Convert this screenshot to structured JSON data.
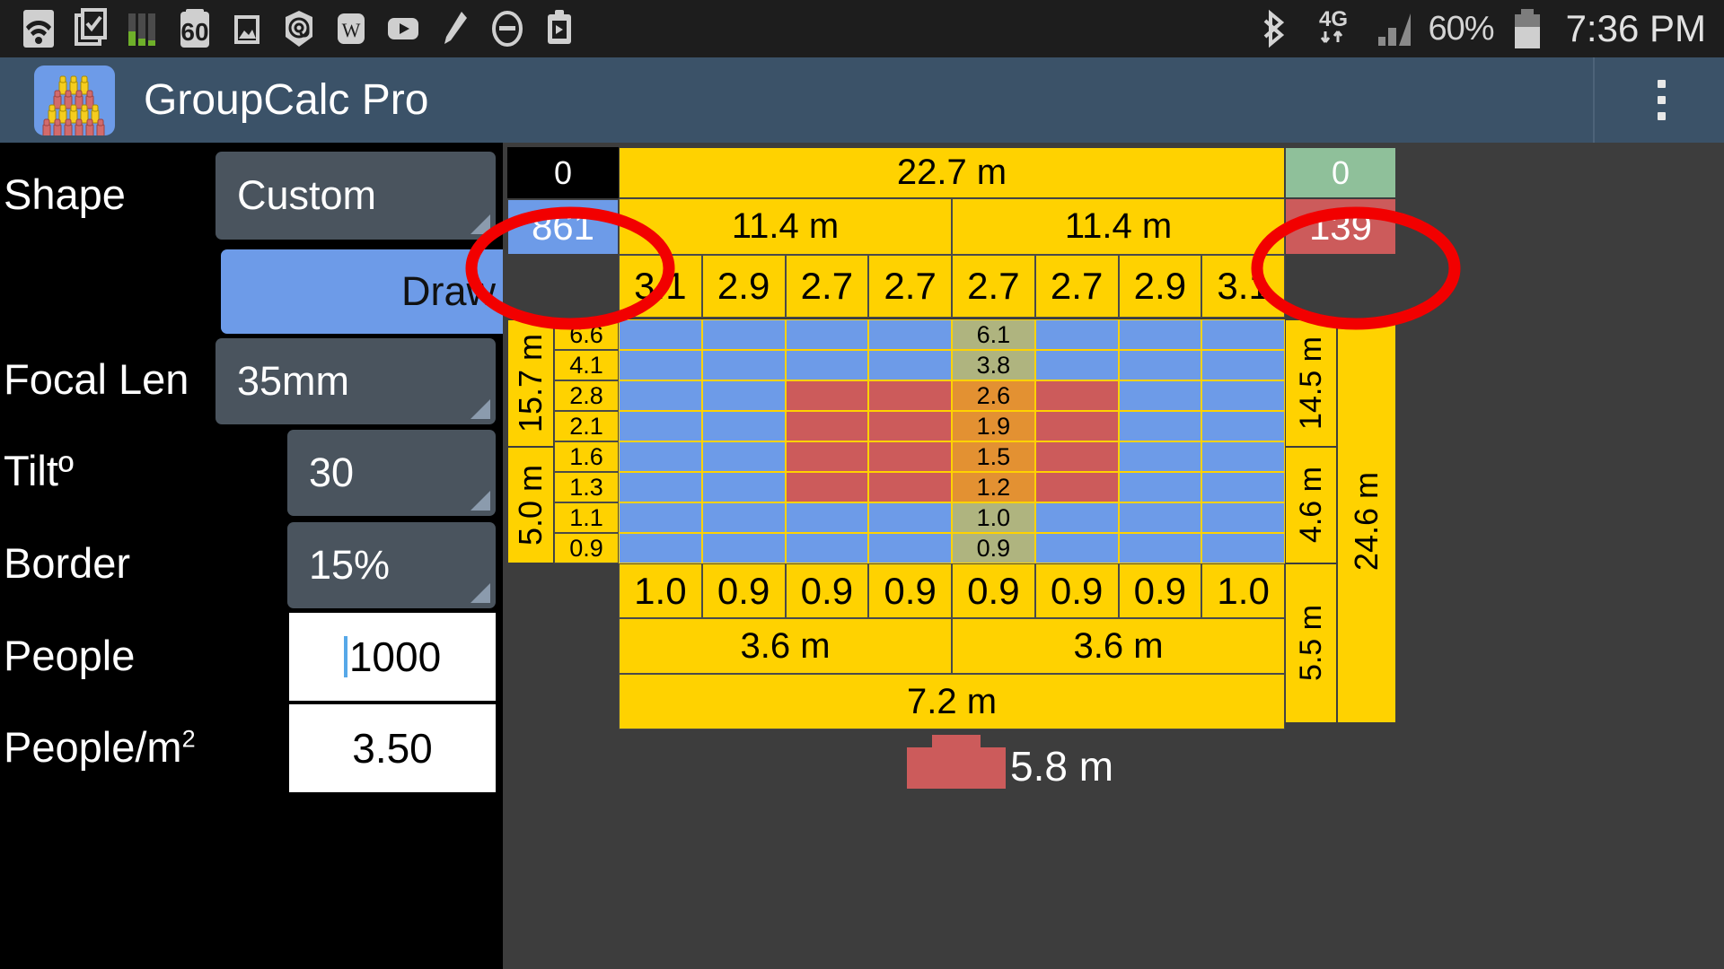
{
  "statusbar": {
    "icons": [
      "wifi-icon",
      "tasks-icon",
      "equalizer-icon",
      "sixty-icon",
      "gallery-icon",
      "at-icon",
      "word-icon",
      "youtube-icon",
      "pen-icon",
      "minus-circle-icon",
      "clipboard-icon"
    ],
    "bluetooth": "bluetooth-icon",
    "network_type": "4G",
    "signal": "signal-icon",
    "battery_percent": "60%",
    "battery": "battery-icon",
    "time": "7:36 PM"
  },
  "appbar": {
    "icon": "groupcalc-app-icon",
    "title": "GroupCalc Pro",
    "overflow": "overflow-menu-icon"
  },
  "controls": [
    {
      "label": "Shape",
      "value": "Custom",
      "type": "spinner"
    },
    {
      "label": "",
      "value": "Draw",
      "type": "button"
    },
    {
      "label": "Focal Len",
      "value": "35mm",
      "type": "spinner"
    },
    {
      "label": "Tiltº",
      "value": "30",
      "type": "spinner"
    },
    {
      "label": "Border",
      "value": "15%",
      "type": "spinner"
    },
    {
      "label": "People",
      "value": "1000",
      "type": "textfield"
    },
    {
      "label": "People/m",
      "sup": "2",
      "value": "3.50",
      "type": "textfield"
    }
  ],
  "diagram": {
    "corner_top_left": "0",
    "count_in_frame": "861",
    "corner_top_right": "0",
    "count_out_frame": "139",
    "total_width": "22.7 m",
    "half_widths": [
      "11.4 m",
      "11.4 m"
    ],
    "column_widths_top": [
      "3.1",
      "2.9",
      "2.7",
      "2.7",
      "2.7",
      "2.7",
      "2.9",
      "3.1"
    ],
    "column_widths_bottom": [
      "1.0",
      "0.9",
      "0.9",
      "0.9",
      "0.9",
      "0.9",
      "0.9",
      "1.0"
    ],
    "left_group_labels": [
      "15.7 m",
      "5.0 m"
    ],
    "right_group_labels": [
      "14.5 m",
      "4.6 m"
    ],
    "right_total_label": "24.6 m",
    "row_values_left": [
      "6.6",
      "4.1",
      "2.8",
      "2.1",
      "1.6",
      "1.3",
      "1.1",
      "0.9"
    ],
    "center_column_values": [
      "6.1",
      "3.8",
      "2.6",
      "1.9",
      "1.5",
      "1.2",
      "1.0",
      "0.9"
    ],
    "bottom_half_widths": [
      "3.6 m",
      "3.6 m"
    ],
    "bottom_total": "7.2 m",
    "stage_label": "5.8 m",
    "grid": [
      [
        "blue",
        "blue",
        "blue",
        "blue",
        "blue",
        "blue",
        "blue",
        "blue"
      ],
      [
        "blue",
        "blue",
        "blue",
        "blue",
        "blue",
        "blue",
        "blue",
        "blue"
      ],
      [
        "blue",
        "blue",
        "red",
        "red",
        "red",
        "red",
        "blue",
        "blue"
      ],
      [
        "blue",
        "blue",
        "red",
        "red",
        "red",
        "red",
        "blue",
        "blue"
      ],
      [
        "blue",
        "blue",
        "red",
        "red",
        "red",
        "red",
        "blue",
        "blue"
      ],
      [
        "blue",
        "blue",
        "red",
        "red",
        "red",
        "red",
        "blue",
        "blue"
      ],
      [
        "blue",
        "blue",
        "blue",
        "blue",
        "blue",
        "blue",
        "blue",
        "blue"
      ],
      [
        "blue",
        "blue",
        "blue",
        "blue",
        "blue",
        "blue",
        "blue",
        "blue"
      ]
    ]
  },
  "colors": {
    "yellow": "#ffd200",
    "blue": "#6d9be8",
    "red": "#cc5b5b",
    "green": "#8fc09a",
    "panel": "#3d3d3d",
    "appbar": "#3b5268",
    "annotation": "#f20000"
  }
}
